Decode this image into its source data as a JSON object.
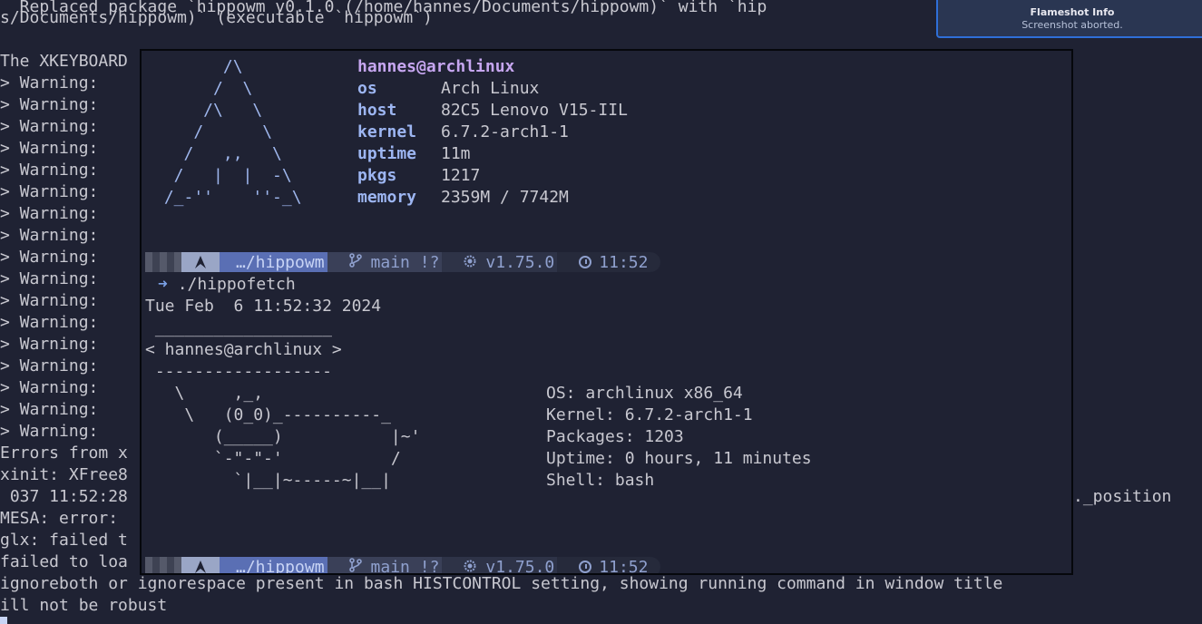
{
  "background_terminal": {
    "lines": [
      "  Replaced package `hippowm v0.1.0 (/home/hannes/Documents/hippowm)` with `hip",
      "s/Documents/hippowm)` (executable `hippowm`)",
      "",
      "The XKEYBOARD",
      "> Warning:",
      "> Warning:",
      "> Warning:",
      "> Warning:",
      "> Warning:",
      "> Warning:",
      "> Warning:",
      "> Warning:",
      "> Warning:",
      "> Warning:",
      "> Warning:",
      "> Warning:",
      "> Warning:",
      "> Warning:",
      "> Warning:",
      "> Warning:",
      "> Warning:",
      "Errors from x",
      "xinit: XFree8",
      " 037 11:52:28",
      "MESA: error:",
      "glx: failed t",
      "failed to loa",
      "ignoreboth or ignorespace present in bash HISTCONTROL setting, showing running command in window title",
      "ill not be robust"
    ],
    "right_fragment": "._position"
  },
  "flameshot": {
    "title": "Flameshot Info",
    "subtitle": "Screenshot aborted."
  },
  "fastfetch": {
    "logo": [
      "       /\\",
      "      /  \\",
      "     /\\   \\",
      "    /      \\",
      "   /   ,,   \\",
      "  /   |  |  -\\",
      " /_-''    ''-_\\"
    ],
    "user": "hannes@archlinux",
    "rows": [
      {
        "key": "os",
        "value": "Arch Linux"
      },
      {
        "key": "host",
        "value": "82C5 Lenovo V15-IIL"
      },
      {
        "key": "kernel",
        "value": "6.7.2-arch1-1"
      },
      {
        "key": "uptime",
        "value": "11m"
      },
      {
        "key": "pkgs",
        "value": "1217"
      },
      {
        "key": "memory",
        "value": "2359M / 7742M"
      }
    ]
  },
  "prompt": {
    "os_icon": "arch-logo-icon",
    "dir": "…/hippowm",
    "git_icon": "git-branch-icon",
    "git": "main !?",
    "rust_icon": "rust-icon",
    "rust": "v1.75.0",
    "clock_icon": "clock-icon",
    "time": "11:52"
  },
  "command": {
    "arrow": "➜",
    "text": "./hippofetch"
  },
  "hippofetch": {
    "date": "Tue Feb  6 11:52:32 2024",
    "bubble": [
      " __________________",
      "< hannes@archlinux >",
      " ------------------"
    ],
    "cow": [
      "   \\     ,_,",
      "    \\   (0_0)_----------_",
      "       (_____)           |~'",
      "       `-\"-\"-'           /",
      "         `|__|~-----~|__|"
    ],
    "info": [
      "OS: archlinux x86_64",
      "Kernel: 6.7.2-arch1-1",
      "Packages: 1203",
      "Uptime: 0 hours, 11 minutes",
      "Shell: bash"
    ]
  },
  "colors": {
    "background": "#1f2233",
    "accent": "#5a6fb4",
    "label": "#9db6f2",
    "user": "#c6a6f0",
    "flameshot_border": "#2f6fd8"
  }
}
